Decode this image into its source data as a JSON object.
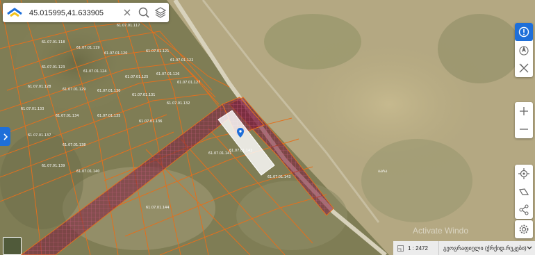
{
  "search": {
    "value": "45.015995,41.633905"
  },
  "icons": {
    "logo": "napr-logo",
    "clear": "close-icon",
    "search": "search-icon",
    "layers": "layers-icon",
    "info": "info-icon",
    "north": "compass-north-icon",
    "measure": "measure-tool-icon",
    "zoom_in": "plus-icon",
    "zoom_out": "minus-icon",
    "locate": "locate-icon",
    "draw": "draw-icon",
    "share": "share-icon",
    "settings": "settings-gear-icon",
    "panel": "chevron-right-icon",
    "pin": "map-pin-icon"
  },
  "colors": {
    "accent": "#1e6fd9",
    "parcel_border": "#e2701e",
    "road_parcel": "#7a1a3a",
    "selected_parcel": "#ffffff"
  },
  "map": {
    "parcel_labels": [
      "61.07.01.117",
      "61.07.01.118",
      "61.07.01.119",
      "61.07.01.120",
      "61.07.01.121",
      "61.07.01.122",
      "61.07.01.123",
      "61.07.01.124",
      "61.07.01.125",
      "61.07.01.126",
      "61.07.01.127",
      "61.07.01.128",
      "61.07.01.129",
      "61.07.01.130",
      "61.07.01.131",
      "61.07.01.132",
      "61.07.01.133",
      "61.07.01.134",
      "61.07.01.135",
      "61.07.01.136",
      "61.07.01.137",
      "61.07.01.138",
      "61.07.01.139",
      "61.07.01.140",
      "61.07.01.141",
      "61.07.01.142",
      "61.07.01.143",
      "61.07.01.144"
    ],
    "terrain_label": "ᲑᲐᲠᲐ"
  },
  "watermark": "Activate Windo",
  "bottombar": {
    "scale": "1 : 2472",
    "layer": "გეოგრაფიული (ქრქიდ.რუკები)"
  }
}
